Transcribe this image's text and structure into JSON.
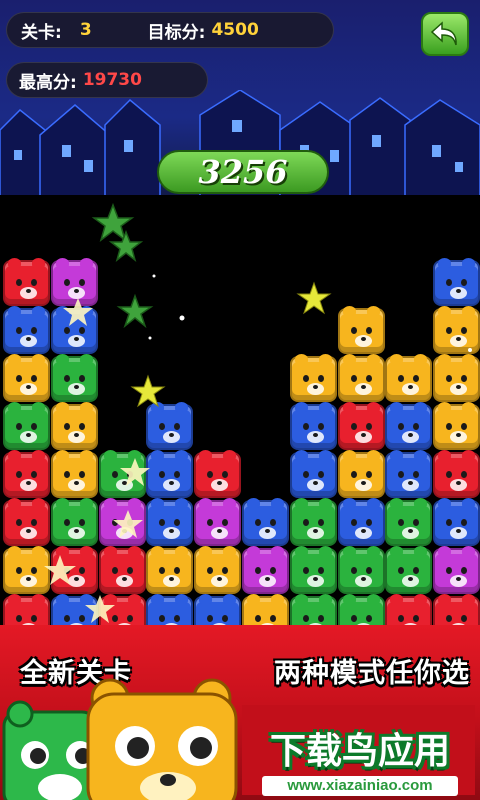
{
  "header": {
    "level_label": "关卡:",
    "level_value": "3",
    "target_label": "目标分:",
    "target_value": "4500",
    "best_label": "最高分:",
    "best_value": "19730",
    "back_icon": "back-arrow-icon"
  },
  "score": {
    "current": "3256"
  },
  "board": {
    "rows": [
      [
        "red",
        "purple",
        "",
        "",
        "",
        "",
        "",
        "",
        "",
        "blue"
      ],
      [
        "blue",
        "blue",
        "",
        "",
        "",
        "",
        "",
        "yellow",
        "",
        "yellow"
      ],
      [
        "yellow",
        "green",
        "",
        "",
        "",
        "",
        "yellow",
        "yellow",
        "yellow",
        "yellow"
      ],
      [
        "green",
        "yellow",
        "",
        "blue",
        "",
        "",
        "blue",
        "red",
        "blue",
        "yellow"
      ],
      [
        "red",
        "yellow",
        "green",
        "blue",
        "red",
        "",
        "blue",
        "yellow",
        "blue",
        "red"
      ],
      [
        "red",
        "green",
        "purple",
        "blue",
        "purple",
        "blue",
        "green",
        "blue",
        "green",
        "blue"
      ],
      [
        "yellow",
        "red",
        "red",
        "yellow",
        "yellow",
        "purple",
        "green",
        "green",
        "green",
        "purple"
      ],
      [
        "red",
        "blue",
        "red",
        "blue",
        "blue",
        "yellow",
        "green",
        "green",
        "red",
        "red"
      ]
    ]
  },
  "banner": {
    "left_text": "全新关卡",
    "right_text": "两种模式任你选",
    "brand": "下载鸟应用",
    "url": "www.xiazainiao.com"
  },
  "colors": {
    "accent_green": "#3c9a22",
    "banner_red": "#e41925",
    "gold": "#ffd23a",
    "best_red": "#ff4848"
  }
}
